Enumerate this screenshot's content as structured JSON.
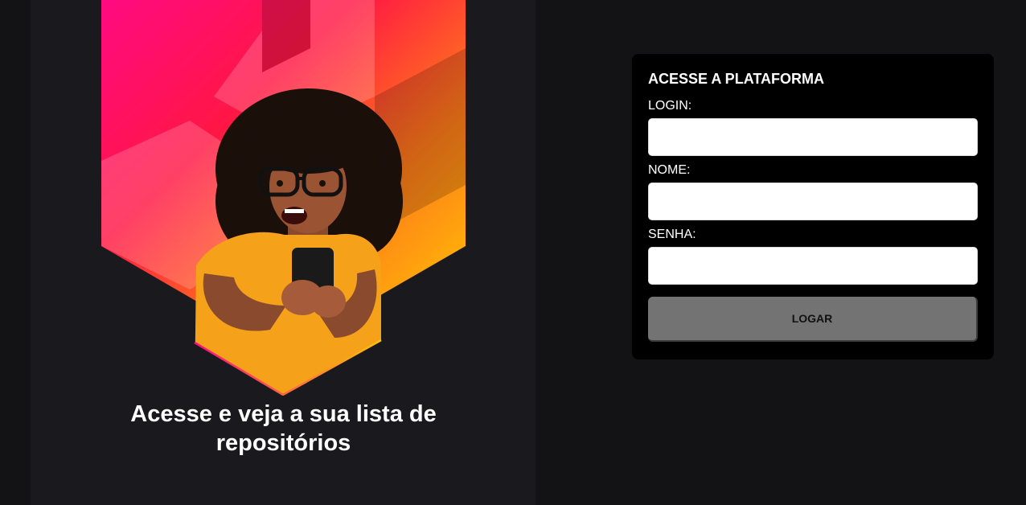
{
  "hero": {
    "tagline": "Acesse e veja a sua lista de repositórios",
    "illustration": "woman-smiling-at-phone-image"
  },
  "login_form": {
    "title": "ACESSE A PLATAFORMA",
    "fields": [
      {
        "label": "LOGIN:",
        "value": "",
        "placeholder": ""
      },
      {
        "label": "NOME:",
        "value": "",
        "placeholder": ""
      },
      {
        "label": "SENHA:",
        "value": "",
        "placeholder": ""
      }
    ],
    "submit_label": "LOGAR"
  },
  "colors": {
    "page_background": "#131316",
    "panel_background": "#1a1a1e",
    "card_background": "#000000",
    "button_background": "#737373",
    "gradient_pink": "#ff0a7a",
    "gradient_red": "#ff1f4a",
    "gradient_orange": "#ff8a1a",
    "gradient_yellow": "#ffd000",
    "shirt_orange": "#f5a21a"
  }
}
